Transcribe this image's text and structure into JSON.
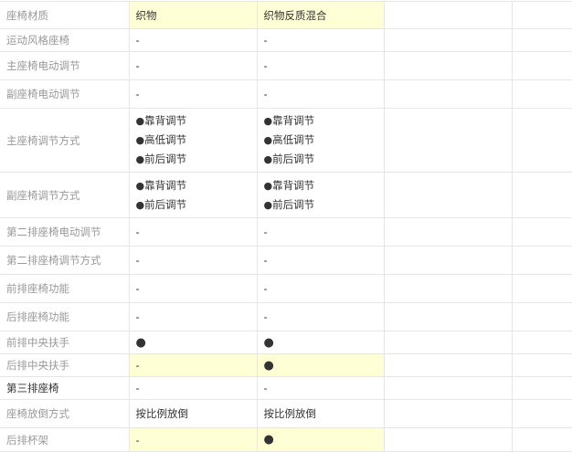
{
  "rows": [
    {
      "label": "座椅材质",
      "label_dark": false,
      "h": 30,
      "v1": "织物",
      "v2": "织物反质混合",
      "hl1": true,
      "hl2": true
    },
    {
      "label": "运动风格座椅",
      "label_dark": false,
      "h": 25,
      "v1": "-",
      "v2": "-"
    },
    {
      "label": "主座椅电动调节",
      "label_dark": false,
      "h": 31,
      "v1": "-",
      "v2": "-"
    },
    {
      "label": "副座椅电动调节",
      "label_dark": false,
      "h": 31,
      "v1": "-",
      "v2": "-"
    },
    {
      "label": "主座椅调节方式",
      "label_dark": false,
      "h": 70,
      "list1": [
        "靠背调节",
        "高低调节",
        "前后调节"
      ],
      "list2": [
        "靠背调节",
        "高低调节",
        "前后调节"
      ]
    },
    {
      "label": "副座椅调节方式",
      "label_dark": false,
      "h": 50,
      "list1": [
        "靠背调节",
        "前后调节"
      ],
      "list2": [
        "靠背调节",
        "前后调节"
      ]
    },
    {
      "label": "第二排座椅电动调节",
      "label_dark": false,
      "h": 31,
      "v1": "-",
      "v2": "-"
    },
    {
      "label": "第二排座椅调节方式",
      "label_dark": false,
      "h": 31,
      "v1": "-",
      "v2": "-"
    },
    {
      "label": "前排座椅功能",
      "label_dark": false,
      "h": 31,
      "v1": "-",
      "v2": "-"
    },
    {
      "label": "后排座椅功能",
      "label_dark": false,
      "h": 31,
      "v1": "-",
      "v2": "-"
    },
    {
      "label": "前排中央扶手",
      "label_dark": false,
      "h": 25,
      "v1": "●",
      "v2": "●",
      "dot1": true,
      "dot2": true
    },
    {
      "label": "后排中央扶手",
      "label_dark": false,
      "h": 25,
      "v1": "-",
      "v2": "●",
      "hl1": true,
      "hl2": true,
      "dot2": true
    },
    {
      "label": "第三排座椅",
      "label_dark": true,
      "h": 25,
      "v1": "-",
      "v2": "-"
    },
    {
      "label": "座椅放倒方式",
      "label_dark": false,
      "h": 31,
      "v1": "按比例放倒",
      "v2": "按比例放倒"
    },
    {
      "label": "后排杯架",
      "label_dark": false,
      "h": 26,
      "v1": "-",
      "v2": "●",
      "hl1": true,
      "hl2": true,
      "dot2": true
    }
  ],
  "bullet": "●"
}
